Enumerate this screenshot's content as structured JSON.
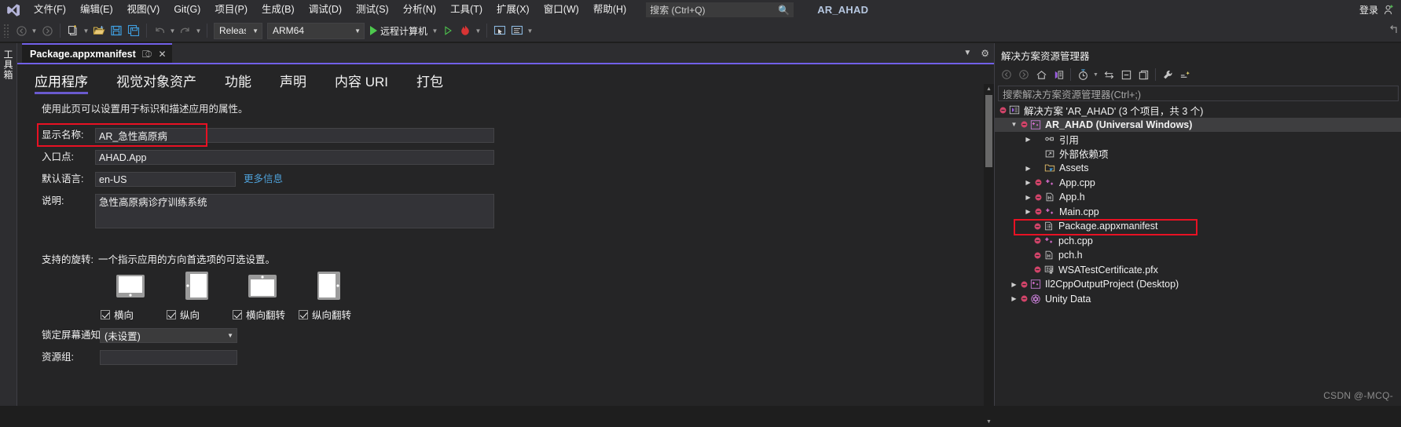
{
  "app": {
    "logo_icon": "visual-studio-logo",
    "solution_name": "AR_AHAD"
  },
  "menubar": {
    "items": [
      {
        "label": "文件(F)",
        "name": "file"
      },
      {
        "label": "编辑(E)",
        "name": "edit"
      },
      {
        "label": "视图(V)",
        "name": "view"
      },
      {
        "label": "Git(G)",
        "name": "git"
      },
      {
        "label": "项目(P)",
        "name": "project"
      },
      {
        "label": "生成(B)",
        "name": "build"
      },
      {
        "label": "调试(D)",
        "name": "debug"
      },
      {
        "label": "测试(S)",
        "name": "test"
      },
      {
        "label": "分析(N)",
        "name": "analyze"
      },
      {
        "label": "工具(T)",
        "name": "tools"
      },
      {
        "label": "扩展(X)",
        "name": "extensions"
      },
      {
        "label": "窗口(W)",
        "name": "window"
      },
      {
        "label": "帮助(H)",
        "name": "help"
      }
    ],
    "search_placeholder": "搜索 (Ctrl+Q)",
    "search_value": "",
    "search_icon": "magnifier-icon",
    "signin_label": "登录",
    "signin_icon": "add-user-icon"
  },
  "toolbar": {
    "back_icon": "navigate-back-icon",
    "forward_icon": "navigate-forward-icon",
    "new_project_icon": "new-project-icon",
    "open_icon": "open-file-icon",
    "save_icon": "save-icon",
    "save_all_icon": "save-all-icon",
    "undo_icon": "undo-icon",
    "redo_icon": "redo-icon",
    "configuration": "Release",
    "platform": "ARM64",
    "run_label": "远程计算机",
    "run_icon": "play-icon",
    "attach_icon": "play-outline-icon",
    "hot_reload_icon": "hot-reload-icon",
    "selection_icon": "select-element-icon",
    "live_visual_tree_icon": "live-visual-tree-icon",
    "overflow_icon": "overflow-chevron-icon"
  },
  "toolbox": {
    "label": "工具箱"
  },
  "document": {
    "tab_title": "Package.appxmanifest",
    "pin_icon": "pin-icon",
    "close_icon": "close-icon",
    "tab_menu_icon": "chevron-down-icon",
    "tab_settings_icon": "gear-icon",
    "manifest_tabs": [
      {
        "label": "应用程序",
        "name": "application",
        "active": true
      },
      {
        "label": "视觉对象资产",
        "name": "visual-assets",
        "active": false
      },
      {
        "label": "功能",
        "name": "capabilities",
        "active": false
      },
      {
        "label": "声明",
        "name": "declarations",
        "active": false
      },
      {
        "label": "内容 URI",
        "name": "content-uri",
        "active": false
      },
      {
        "label": "打包",
        "name": "packaging",
        "active": false
      }
    ],
    "hint": "使用此页可以设置用于标识和描述应用的属性。",
    "fields": {
      "display_name_label": "显示名称:",
      "display_name_value": "AR_急性高原病",
      "entry_point_label": "入口点:",
      "entry_point_value": "AHAD.App",
      "default_language_label": "默认语言:",
      "default_language_value": "en-US",
      "more_info_link": "更多信息",
      "description_label": "说明:",
      "description_value": "急性高原病诊疗训练系统",
      "rotation_label": "支持的旋转:",
      "rotation_hint": "一个指示应用的方向首选项的可选设置。",
      "lock_screen_label": "锁定屏幕通知:",
      "lock_screen_value": "(未设置)",
      "resource_group_label": "资源组:",
      "resource_group_value": ""
    },
    "rotations": [
      {
        "label": "横向",
        "name": "landscape",
        "checked": true,
        "glyph": "tablet-landscape-icon"
      },
      {
        "label": "纵向",
        "name": "portrait",
        "checked": true,
        "glyph": "tablet-portrait-icon"
      },
      {
        "label": "横向翻转",
        "name": "landscape-flipped",
        "checked": true,
        "glyph": "tablet-landscape-flipped-icon"
      },
      {
        "label": "纵向翻转",
        "name": "portrait-flipped",
        "checked": true,
        "glyph": "tablet-portrait-flipped-icon"
      }
    ]
  },
  "solution_explorer": {
    "title": "解决方案资源管理器",
    "search_placeholder": "搜索解决方案资源管理器(Ctrl+;)",
    "toolbar": {
      "back_icon": "navigate-back-icon",
      "forward_icon": "navigate-forward-icon",
      "home_icon": "home-icon",
      "pending_changes_icon": "solution-view-icon",
      "history_icon": "history-icon",
      "history_caret_icon": "chevron-down-icon",
      "sync_icon": "sync-with-active-document-icon",
      "collapse_all_icon": "collapse-all-icon",
      "show_all_files_icon": "show-all-files-icon",
      "properties_icon": "wrench-properties-icon",
      "preview_icon": "preview-selected-items-icon"
    },
    "tree": [
      {
        "label": "解决方案 'AR_AHAD' (3 个项目，共 3 个)",
        "name": "solution-root",
        "indent": 0,
        "icon": "solution-icon",
        "twist": "expanded-none",
        "status": "minus",
        "bold": false,
        "selected": false
      },
      {
        "label": "AR_AHAD (Universal Windows)",
        "name": "project-ar-ahad",
        "indent": 1,
        "icon": "cpp-project-icon",
        "twist": "expanded",
        "status": "minus",
        "bold": true,
        "selected": true
      },
      {
        "label": "引用",
        "name": "references",
        "indent": 2,
        "icon": "references-icon",
        "twist": "collapsed",
        "status": "none",
        "bold": false,
        "selected": false
      },
      {
        "label": "外部依赖项",
        "name": "external-dependencies",
        "indent": 2,
        "icon": "external-dependencies-icon",
        "twist": "none",
        "status": "none",
        "bold": false,
        "selected": false
      },
      {
        "label": "Assets",
        "name": "assets-folder",
        "indent": 2,
        "icon": "folder-icon",
        "twist": "collapsed",
        "status": "none",
        "bold": false,
        "selected": false
      },
      {
        "label": "App.cpp",
        "name": "file-app-cpp",
        "indent": 2,
        "icon": "cpp-file-icon",
        "twist": "collapsed",
        "status": "minus",
        "bold": false,
        "selected": false
      },
      {
        "label": "App.h",
        "name": "file-app-h",
        "indent": 2,
        "icon": "header-file-icon",
        "twist": "collapsed",
        "status": "minus",
        "bold": false,
        "selected": false
      },
      {
        "label": "Main.cpp",
        "name": "file-main-cpp",
        "indent": 2,
        "icon": "cpp-file-icon",
        "twist": "collapsed",
        "status": "minus",
        "bold": false,
        "selected": false
      },
      {
        "label": "Package.appxmanifest",
        "name": "file-package-appxmanifest",
        "indent": 2,
        "icon": "manifest-file-icon",
        "twist": "none",
        "status": "minus",
        "bold": false,
        "selected": false,
        "highlighted": true
      },
      {
        "label": "pch.cpp",
        "name": "file-pch-cpp",
        "indent": 2,
        "icon": "cpp-file-icon",
        "twist": "none",
        "status": "minus",
        "bold": false,
        "selected": false
      },
      {
        "label": "pch.h",
        "name": "file-pch-h",
        "indent": 2,
        "icon": "header-file-icon",
        "twist": "none",
        "status": "minus",
        "bold": false,
        "selected": false
      },
      {
        "label": "WSATestCertificate.pfx",
        "name": "file-wsa-test-certificate",
        "indent": 2,
        "icon": "certificate-icon",
        "twist": "none",
        "status": "minus",
        "bold": false,
        "selected": false
      },
      {
        "label": "Il2CppOutputProject (Desktop)",
        "name": "project-il2cpp-output",
        "indent": 1,
        "icon": "cpp-project-icon",
        "twist": "collapsed",
        "status": "minus",
        "bold": false,
        "selected": false
      },
      {
        "label": "Unity Data",
        "name": "project-unity-data",
        "indent": 1,
        "icon": "unity-icon",
        "twist": "collapsed",
        "status": "minus",
        "bold": false,
        "selected": false
      }
    ]
  },
  "watermark": "CSDN @-MCQ-",
  "colors": {
    "accent_purple": "#7160e8",
    "highlight_red": "#e81123",
    "link_blue": "#4ea0d8",
    "solution_text": "#b6c7e0",
    "background": "#1e1e1e",
    "panel": "#252526",
    "chrome": "#2d2d30"
  }
}
